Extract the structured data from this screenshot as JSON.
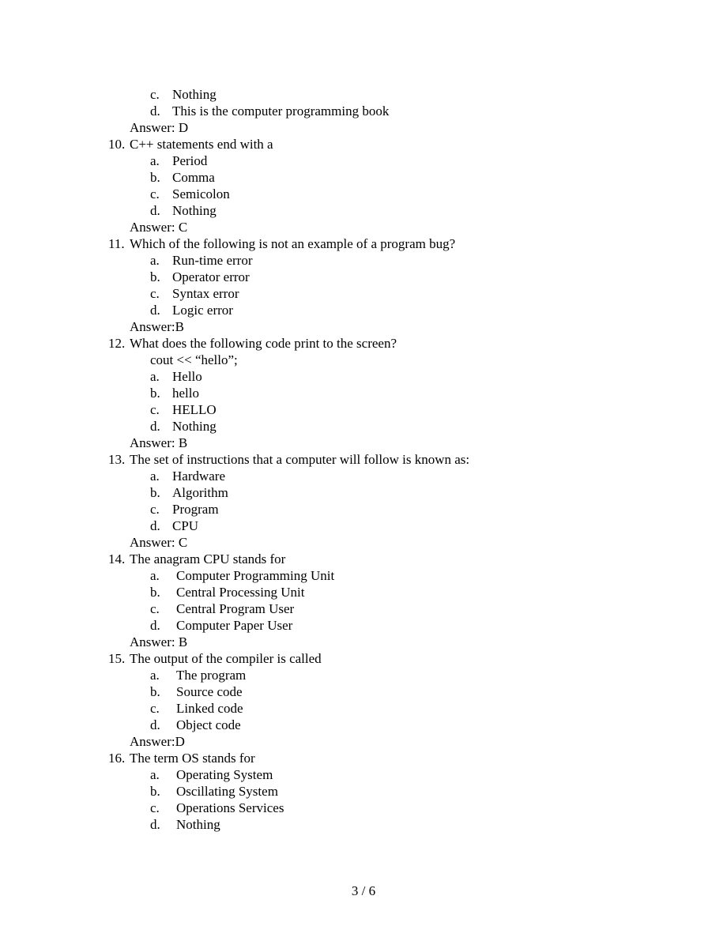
{
  "document": {
    "page_footer": "3 / 6",
    "answer_prefix_spaced": "Answer: ",
    "answer_prefix_tight": "Answer:"
  },
  "continued_question": {
    "options": [
      {
        "letter": "c.",
        "text": "Nothing"
      },
      {
        "letter": "d.",
        "text": "This is the computer programming book"
      }
    ],
    "answer_label": "Answer: D"
  },
  "questions": [
    {
      "number": "10.",
      "stem": "C++ statements end with a",
      "options": [
        {
          "letter": "a.",
          "text": "Period"
        },
        {
          "letter": "b.",
          "text": "Comma"
        },
        {
          "letter": "c.",
          "text": "Semicolon"
        },
        {
          "letter": "d.",
          "text": "Nothing"
        }
      ],
      "answer_label": "Answer: C"
    },
    {
      "number": "11.",
      "stem": "Which of the following is not an example of a program bug?",
      "options": [
        {
          "letter": "a.",
          "text": "Run-time error"
        },
        {
          "letter": "b.",
          "text": "Operator error"
        },
        {
          "letter": "c.",
          "text": "Syntax error"
        },
        {
          "letter": "d.",
          "text": "Logic error"
        }
      ],
      "answer_label": "Answer:B"
    },
    {
      "number": "12.",
      "stem": "What does the following code print to the screen?",
      "snippet": "cout << “hello”;",
      "options": [
        {
          "letter": "a.",
          "text": "Hello"
        },
        {
          "letter": "b.",
          "text": "hello"
        },
        {
          "letter": "c.",
          "text": "HELLO"
        },
        {
          "letter": "d.",
          "text": "Nothing"
        }
      ],
      "answer_label": "Answer: B"
    },
    {
      "number": "13.",
      "stem": "The set of instructions that a computer will follow is known as:",
      "options": [
        {
          "letter": "a.",
          "text": "Hardware"
        },
        {
          "letter": "b.",
          "text": "Algorithm"
        },
        {
          "letter": "c.",
          "text": "Program"
        },
        {
          "letter": "d.",
          "text": "CPU"
        }
      ],
      "answer_label": "Answer: C"
    },
    {
      "number": "14.",
      "stem": "The anagram CPU stands for",
      "options": [
        {
          "letter": "a.",
          "text": "Computer Programming Unit"
        },
        {
          "letter": "b.",
          "text": "Central Processing Unit"
        },
        {
          "letter": "c.",
          "text": "Central Program User"
        },
        {
          "letter": "d.",
          "text": "Computer Paper User"
        }
      ],
      "answer_label": "Answer: B"
    },
    {
      "number": "15.",
      "stem": "The output of the compiler is called",
      "options": [
        {
          "letter": "a.",
          "text": "The program"
        },
        {
          "letter": "b.",
          "text": "Source code"
        },
        {
          "letter": "c.",
          "text": "Linked code"
        },
        {
          "letter": "d.",
          "text": "Object code"
        }
      ],
      "answer_label": "Answer:D"
    },
    {
      "number": "16.",
      "stem": "The term OS stands for",
      "options": [
        {
          "letter": "a.",
          "text": "Operating System"
        },
        {
          "letter": "b.",
          "text": "Oscillating System"
        },
        {
          "letter": "c.",
          "text": "Operations Services"
        },
        {
          "letter": "d.",
          "text": "Nothing"
        }
      ],
      "answer_label": ""
    }
  ]
}
